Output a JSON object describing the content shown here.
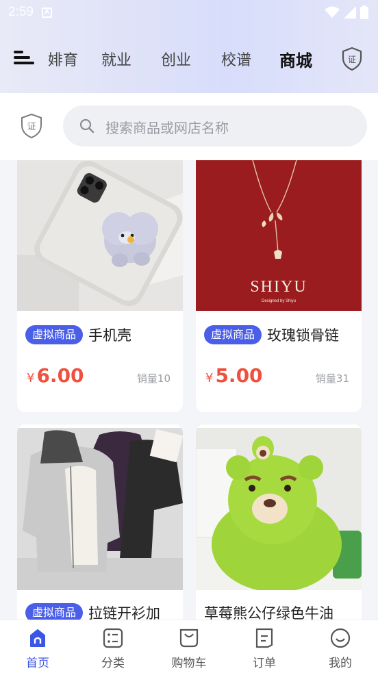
{
  "status_bar": {
    "time": "2:59"
  },
  "nav": {
    "tabs": [
      {
        "label": "婔育",
        "active": false
      },
      {
        "label": "就业",
        "active": false
      },
      {
        "label": "创业",
        "active": false
      },
      {
        "label": "校谱",
        "active": false
      },
      {
        "label": "商城",
        "active": true
      }
    ],
    "shield_text": "证"
  },
  "search": {
    "shield_text": "证",
    "placeholder": "搜索商品或网店名称"
  },
  "products": [
    {
      "badge": "虚拟商品",
      "title": "手机壳",
      "currency": "¥",
      "price": "6.00",
      "sales": "销量10",
      "image": "phone-case"
    },
    {
      "badge": "虚拟商品",
      "title": "玫瑰锁骨链",
      "currency": "¥",
      "price": "5.00",
      "sales": "销量31",
      "image": "necklace",
      "image_text": "SHIYU",
      "image_subtext": "Designed by Shiyu"
    },
    {
      "badge": "虚拟商品",
      "title": "拉链开衫加",
      "image": "hoodies"
    },
    {
      "badge": "",
      "title": "草莓熊公仔绿色牛油",
      "image": "green-bear"
    }
  ],
  "tabbar": {
    "items": [
      {
        "label": "首页",
        "icon": "home-icon",
        "active": true
      },
      {
        "label": "分类",
        "icon": "category-icon",
        "active": false
      },
      {
        "label": "购物车",
        "icon": "cart-icon",
        "active": false
      },
      {
        "label": "订单",
        "icon": "order-icon",
        "active": false
      },
      {
        "label": "我的",
        "icon": "profile-icon",
        "active": false
      }
    ]
  },
  "colors": {
    "accent": "#3b55e6",
    "badge": "#4a5ee8",
    "price": "#f0513e",
    "necklace_bg": "#9b1c1e",
    "bear_green": "#9fd43a"
  }
}
